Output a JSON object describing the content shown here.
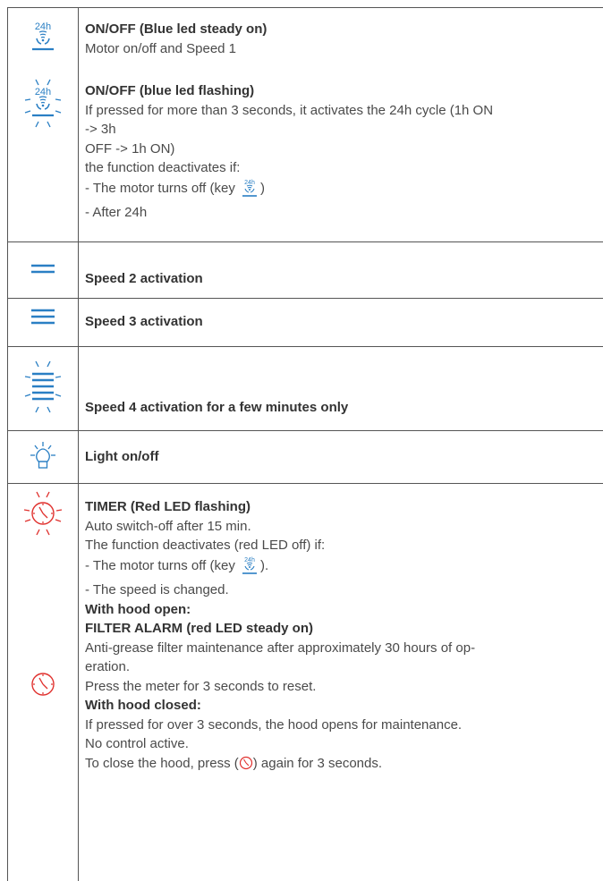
{
  "colors": {
    "blue": "#2a7fc4",
    "red": "#e0312e",
    "border": "#555555",
    "text": "#4a4a4a"
  },
  "rows": {
    "onoff_steady": {
      "icon": "24h-fan-blue-icon",
      "title": "ON/OFF (Blue led steady on)",
      "line1": "Motor on/off and Speed 1"
    },
    "onoff_flashing": {
      "icon": "24h-fan-blue-flashing-icon",
      "title": "ON/OFF (blue led flashing)",
      "line1": "If pressed for more than 3 seconds, it activates the 24h cycle (1h ON",
      "line2": "-> 3h",
      "line3": "OFF -> 1h ON)",
      "line4": "the function deactivates if:",
      "line5_pre": "- The motor turns off (key ",
      "line5_post": ")",
      "line6": "- After 24h"
    },
    "speed2": {
      "icon": "speed-2-icon",
      "title": "Speed 2 activation"
    },
    "speed3": {
      "icon": "speed-3-icon",
      "title": "Speed 3 activation"
    },
    "speed4": {
      "icon": "speed-4-flashing-icon",
      "title": "Speed 4 activation for a few minutes only"
    },
    "light": {
      "icon": "light-bulb-icon",
      "title": "Light on/off"
    },
    "timer": {
      "icon_flashing": "timer-clock-flashing-icon",
      "icon_steady": "timer-clock-icon",
      "title": "TIMER (Red LED flashing)",
      "line1": "Auto switch-off after 15 min.",
      "line2": "The function deactivates (red LED off) if:",
      "line3_pre": "- The motor turns off (key ",
      "line3_post": ").",
      "line4": "- The speed is changed.",
      "open_heading": "With hood open:",
      "filter_heading": "FILTER ALARM (red LED steady on)",
      "filter_line1": "Anti-grease filter maintenance after approximately 30 hours of op-",
      "filter_line2": "eration.",
      "filter_line3": "Press the meter for 3 seconds to reset.",
      "closed_heading": "With hood closed:",
      "closed_line1": "If pressed for over 3 seconds, the hood opens for maintenance.",
      "closed_line2": "No control active.",
      "closed_line3_pre": "To close the hood, press (",
      "closed_line3_post": ") again for 3 seconds."
    }
  }
}
